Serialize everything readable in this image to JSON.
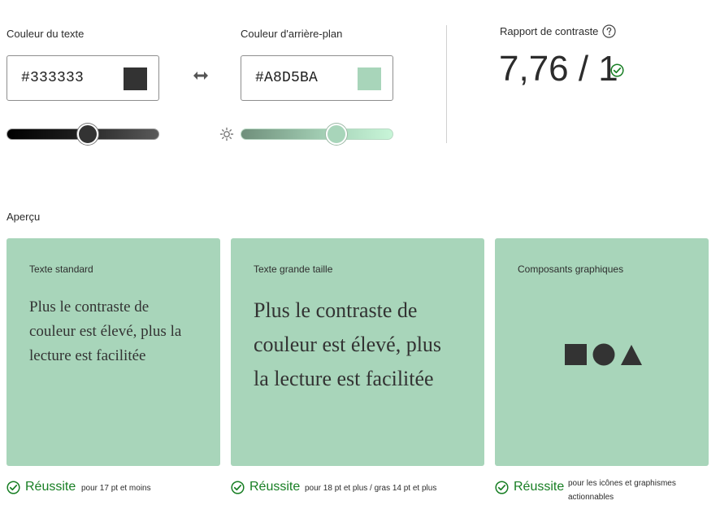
{
  "text_color": {
    "label": "Couleur du texte",
    "hex": "#333333",
    "swatch": "#333333",
    "slider_value": 0.53
  },
  "background_color": {
    "label": "Couleur d'arrière-plan",
    "hex": "#A8D5BA",
    "swatch": "#A8D5BA",
    "slider_value": 0.63
  },
  "contrast": {
    "label": "Rapport de contraste",
    "value": "7,76 / 1"
  },
  "preview": {
    "label": "Aperçu",
    "card_bg": "#A8D5BA",
    "cards": [
      {
        "title": "Texte standard",
        "body": "Plus le contraste de couleur est élevé, plus la lecture est facilitée"
      },
      {
        "title": "Texte grande taille",
        "body": "Plus le contraste de couleur est élevé, plus la lecture est facilitée"
      },
      {
        "title": "Composants graphiques"
      }
    ]
  },
  "results": [
    {
      "status": "Réussite",
      "note": "pour 17 pt et moins"
    },
    {
      "status": "Réussite",
      "note": "pour 18 pt et plus / gras 14 pt et plus"
    },
    {
      "status": "Réussite",
      "note": "pour les icônes et graphismes actionnables"
    }
  ],
  "colors": {
    "pass_green": "#177E23",
    "text_dark": "#333333",
    "accent_bg": "#A8D5BA"
  }
}
